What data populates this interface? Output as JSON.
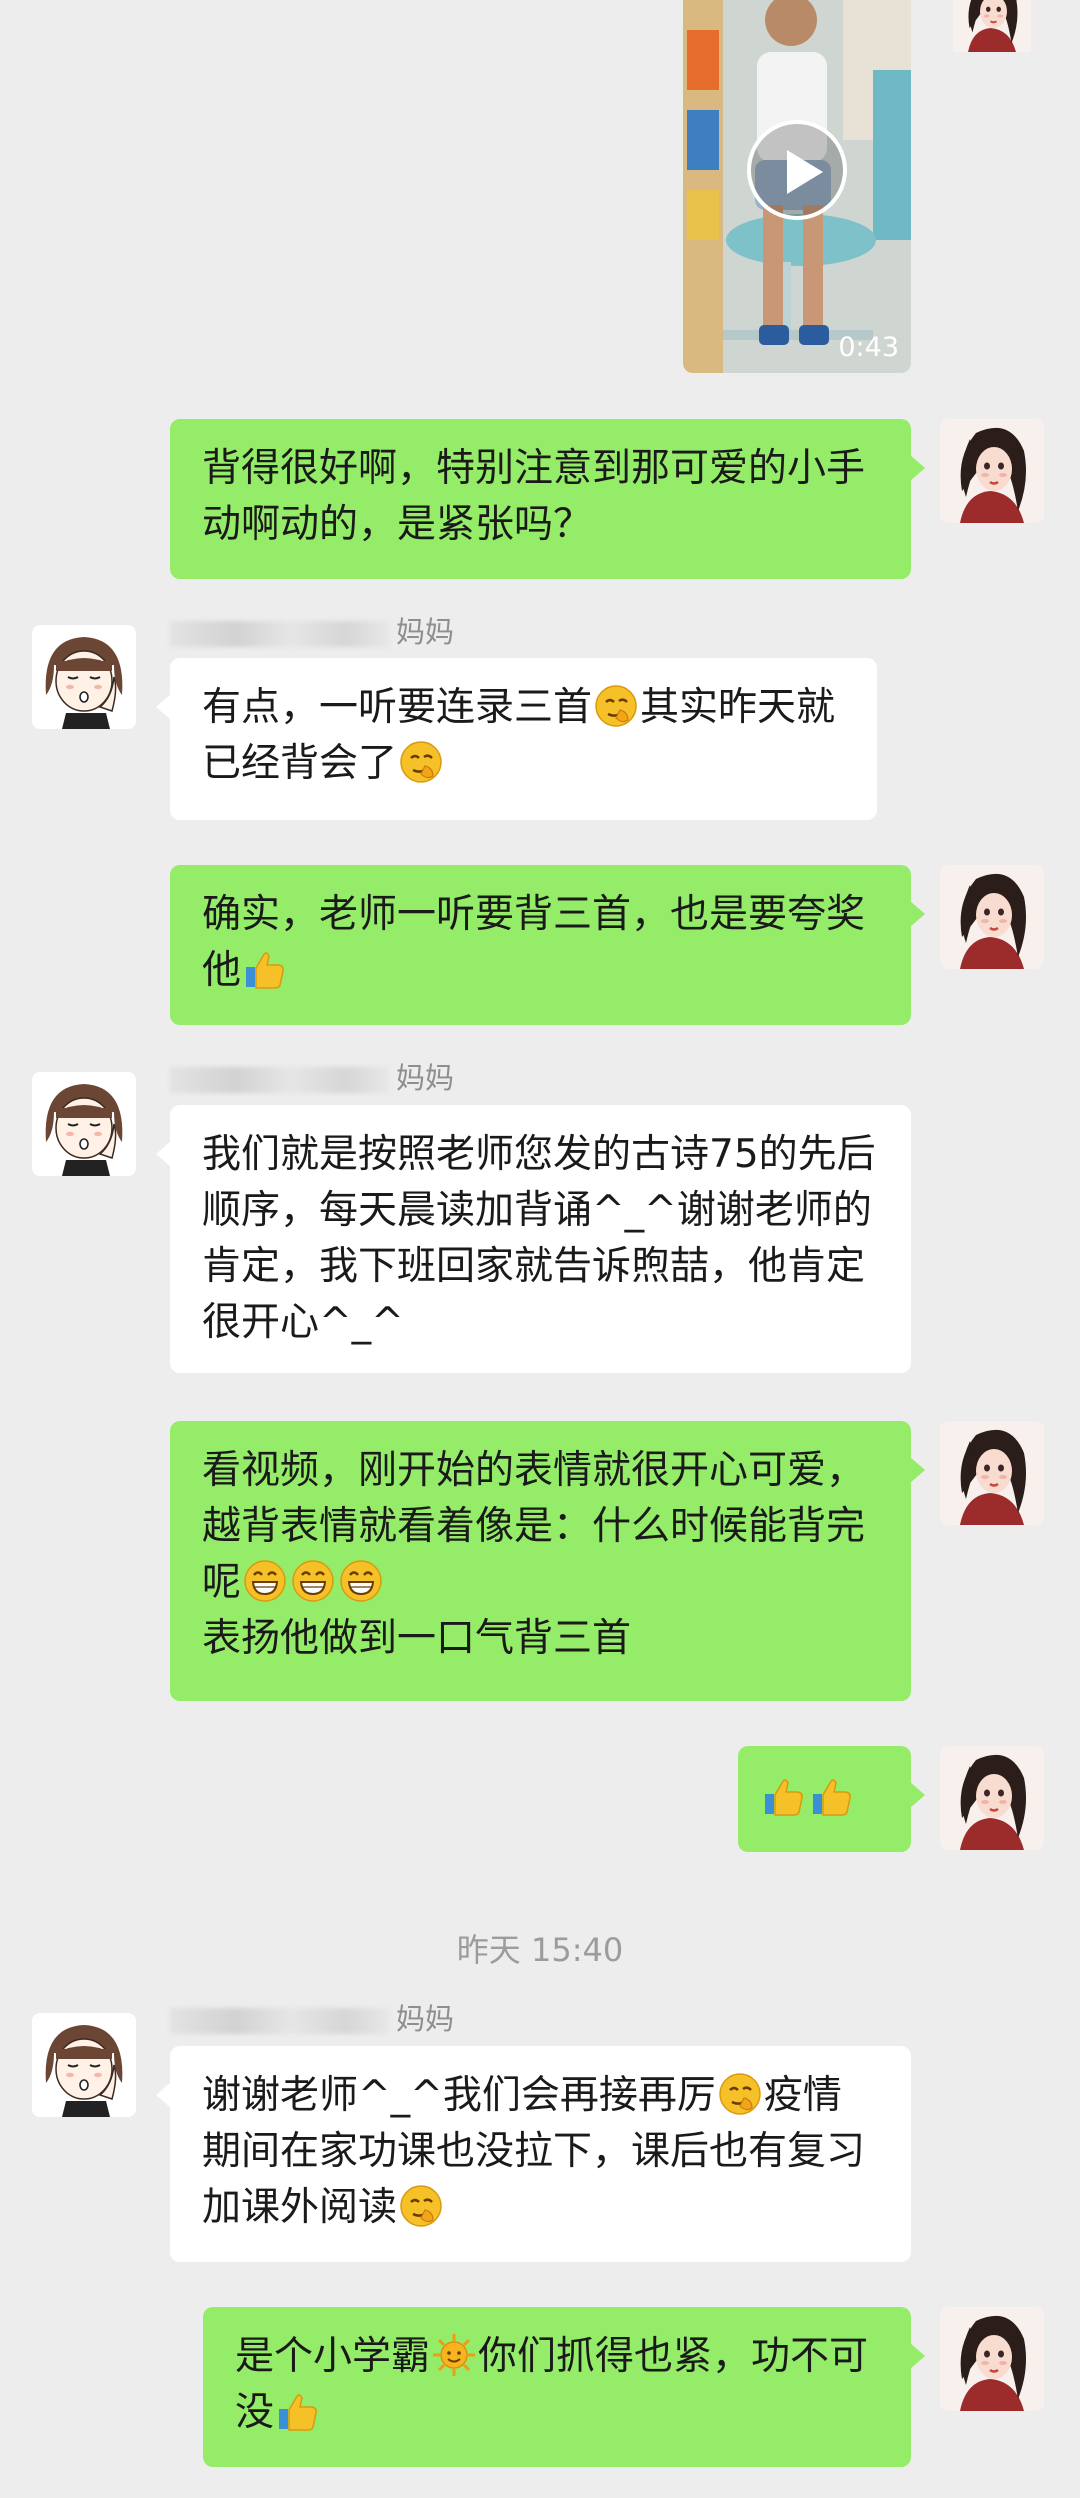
{
  "colors": {
    "self_bubble": "#95ec69",
    "other_bubble": "#ffffff",
    "background": "#ededed",
    "timestamp": "#9c9c9c"
  },
  "video": {
    "duration": "0:43",
    "play_icon": "play-icon"
  },
  "messages": [
    {
      "side": "self",
      "text": "背得很好啊，特别注意到那可爱的小手动啊动的，是紧张吗？"
    },
    {
      "side": "other",
      "sender": "妈妈",
      "text_parts": [
        "有点，一听要连录三首",
        "smirk",
        "其实昨天就已经背会了",
        "smirk"
      ]
    },
    {
      "side": "self",
      "text_parts": [
        "确实，老师一听要背三首，也是要夸奖他",
        "thumbs-up"
      ]
    },
    {
      "side": "other",
      "sender": "妈妈",
      "text": "我们就是按照老师您发的古诗75的先后顺序，每天晨读加背诵^_^谢谢老师的肯定，我下班回家就告诉煦喆，他肯定很开心^_^"
    },
    {
      "side": "self",
      "text_a": "看视频，刚开始的表情就很开心可爱，越背表情就看着像是：什么时候能背完呢",
      "emojis": [
        "grin",
        "grin",
        "grin"
      ],
      "text_b": "表扬他做到一口气背三首"
    },
    {
      "side": "self",
      "emojis": [
        "thumbs-up",
        "thumbs-up"
      ]
    },
    {
      "side": "other",
      "sender": "妈妈",
      "text_parts": [
        "谢谢老师^_^我们会再接再厉",
        "smirk",
        "疫情期间在家功课也没拉下，课后也有复习加课外阅读",
        "smirk"
      ]
    },
    {
      "side": "self",
      "text_parts": [
        "是个小学霸",
        "sun",
        "你们抓得也紧，功不可没",
        "thumbs-up"
      ]
    }
  ],
  "timestamp": "昨天 15:40"
}
